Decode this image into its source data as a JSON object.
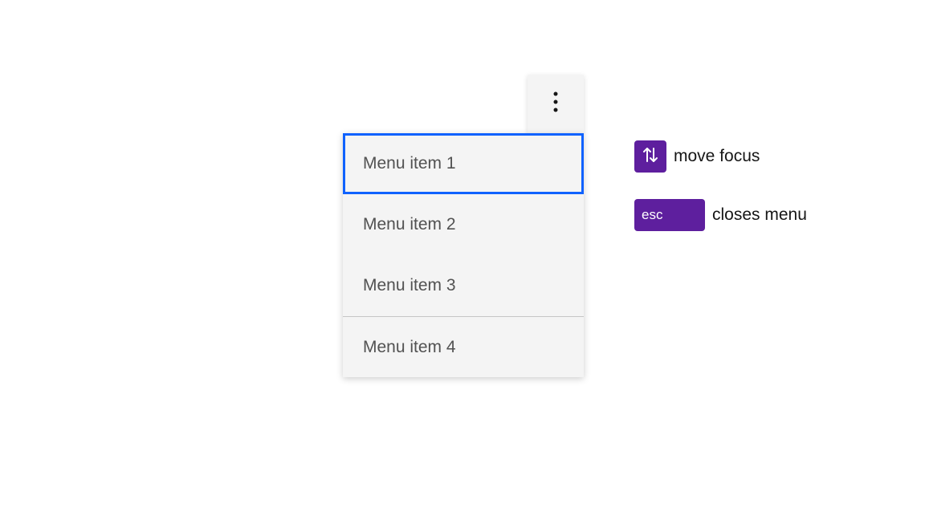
{
  "menu": {
    "items": [
      {
        "label": "Menu item 1",
        "focused": true
      },
      {
        "label": "Menu item 2",
        "focused": false
      },
      {
        "label": "Menu item 3",
        "focused": false
      },
      {
        "label": "Menu item 4",
        "focused": false,
        "divider": true
      }
    ]
  },
  "hints": {
    "arrows": {
      "label": "move focus"
    },
    "esc": {
      "key": "esc",
      "label": "closes menu"
    }
  }
}
